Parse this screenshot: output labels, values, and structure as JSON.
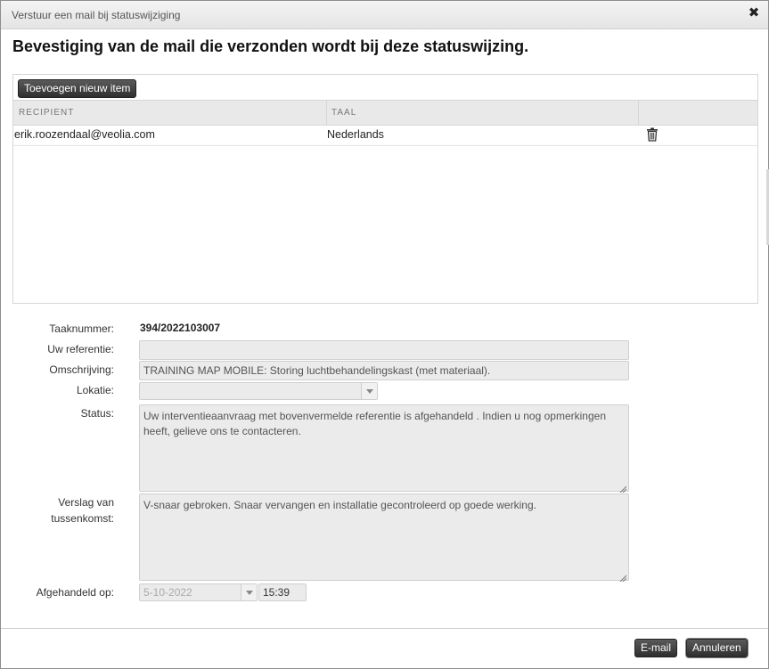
{
  "window": {
    "title": "Verstuur een mail bij statuswijziging",
    "close_icon": "✖"
  },
  "heading": "Bevestiging van de mail die verzonden wordt bij deze statuswijzing.",
  "grid": {
    "add_button": "Toevoegen nieuw item",
    "columns": [
      "RECIPIENT",
      "TAAL"
    ],
    "rows": [
      {
        "recipient": "erik.roozendaal@veolia.com",
        "taal": "Nederlands",
        "action_icon": "trash-icon"
      }
    ]
  },
  "form": {
    "taaknummer_label": "Taaknummer:",
    "taaknummer_value": "394/2022103007",
    "referentie_label": "Uw referentie:",
    "referentie_value": "",
    "omschrijving_label": "Omschrijving:",
    "omschrijving_value": "TRAINING MAP MOBILE: Storing luchtbehandelingskast (met materiaal).",
    "lokatie_label": "Lokatie:",
    "lokatie_value": "",
    "status_label": "Status:",
    "status_value": "Uw interventieaanvraag met bovenvermelde referentie is afgehandeld . Indien u nog opmerkingen heeft, gelieve ons te contacteren.",
    "verslag_label_1": "Verslag van",
    "verslag_label_2": "tussenkomst:",
    "verslag_value": "V-snaar gebroken. Snaar vervangen en installatie gecontroleerd op goede werking.",
    "afgehandeld_label": "Afgehandeld op:",
    "afgehandeld_date": "5-10-2022",
    "afgehandeld_time": "15:39"
  },
  "footer": {
    "email_button": "E-mail",
    "cancel_button": "Annuleren"
  }
}
